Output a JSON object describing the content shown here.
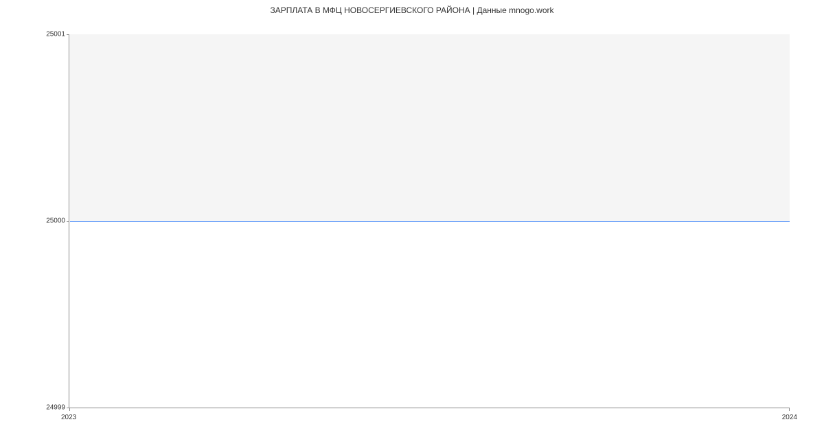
{
  "chart_data": {
    "type": "line",
    "title": "ЗАРПЛАТА В МФЦ НОВОСЕРГИЕВСКОГО РАЙОНА | Данные mnogo.work",
    "x": [
      "2023",
      "2024"
    ],
    "values": [
      25000,
      25000
    ],
    "xlabel": "",
    "ylabel": "",
    "ylim": [
      24999,
      25001
    ],
    "y_ticks": [
      "25001",
      "25000",
      "24999"
    ],
    "x_ticks": [
      "2023",
      "2024"
    ]
  }
}
